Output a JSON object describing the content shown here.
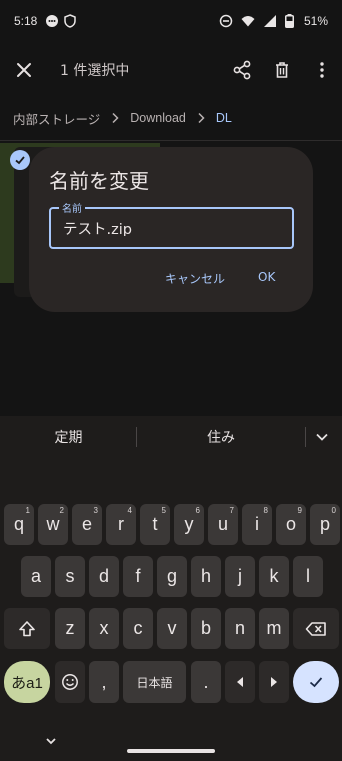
{
  "status_bar": {
    "time": "5:18",
    "battery_percent": "51%",
    "icons": [
      "chat-bubble-icon",
      "shield-icon",
      "do-not-disturb-icon",
      "wifi-icon",
      "signal-icon",
      "battery-icon"
    ]
  },
  "app_bar": {
    "title": "1 件選択中",
    "actions": [
      "share-icon",
      "delete-icon",
      "more-vert-icon"
    ]
  },
  "breadcrumb": {
    "items": [
      "内部ストレージ",
      "Download",
      "DL"
    ]
  },
  "dialog": {
    "title": "名前を変更",
    "field_label": "名前",
    "field_value": "テスト.zip",
    "cancel_label": "キャンセル",
    "ok_label": "OK"
  },
  "keyboard": {
    "suggestions": [
      "定期",
      "住み"
    ],
    "row1": [
      {
        "key": "q",
        "hint": "1"
      },
      {
        "key": "w",
        "hint": "2"
      },
      {
        "key": "e",
        "hint": "3"
      },
      {
        "key": "r",
        "hint": "4"
      },
      {
        "key": "t",
        "hint": "5"
      },
      {
        "key": "y",
        "hint": "6"
      },
      {
        "key": "u",
        "hint": "7"
      },
      {
        "key": "i",
        "hint": "8"
      },
      {
        "key": "o",
        "hint": "9"
      },
      {
        "key": "p",
        "hint": "0"
      }
    ],
    "row2": [
      "a",
      "s",
      "d",
      "f",
      "g",
      "h",
      "j",
      "k",
      "l"
    ],
    "row3": [
      "z",
      "x",
      "c",
      "v",
      "b",
      "n",
      "m"
    ],
    "lang_key": "あa1",
    "comma": ",",
    "space_label": "日本語",
    "period": ".",
    "colors": {
      "enter": "#d6e3ff",
      "lang": "#c7d5a0",
      "accent": "#a8c7fa"
    }
  }
}
